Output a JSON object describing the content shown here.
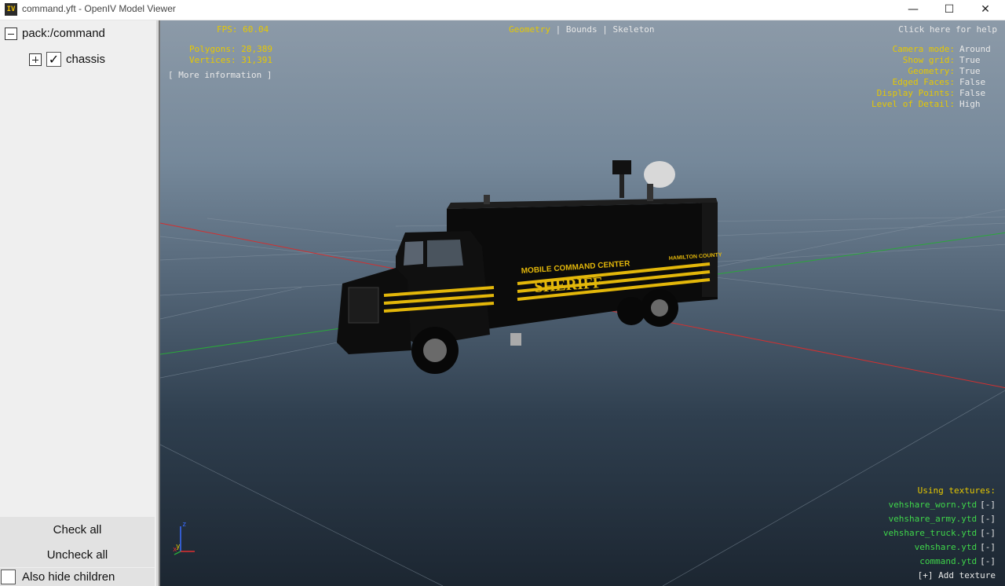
{
  "window": {
    "title": "command.yft - OpenIV Model Viewer",
    "app_icon": "IV",
    "buttons": {
      "minimize": "—",
      "maximize": "☐",
      "close": "✕"
    }
  },
  "tree": {
    "root_label": "pack:/command",
    "child_label": "chassis",
    "child_checked": true
  },
  "panel_buttons": {
    "check_all": "Check all",
    "uncheck_all": "Uncheck all",
    "also_hide_children": "Also hide children"
  },
  "hud": {
    "fps": "FPS: 60.04",
    "polygons": "Polygons: 28,389",
    "vertices": "Vertices: 31,391",
    "more_info": "[ More information ]",
    "help": "Click here for help",
    "modes": {
      "geometry": "Geometry",
      "bounds": "Bounds",
      "skeleton": "Skeleton",
      "active": "Geometry"
    },
    "options": [
      {
        "key": "Camera mode:",
        "value": "Around"
      },
      {
        "key": "Show grid:",
        "value": "True"
      },
      {
        "key": "Geometry:",
        "value": "True"
      },
      {
        "key": "Edged Faces:",
        "value": "False"
      },
      {
        "key": "Display Points:",
        "value": "False"
      },
      {
        "key": "Level of Detail:",
        "value": "High"
      }
    ],
    "textures_title": "Using textures:",
    "textures": [
      "vehshare_worn.ytd",
      "vehshare_army.ytd",
      "vehshare_truck.ytd",
      "vehshare.ytd",
      "command.ytd"
    ],
    "texture_remove": "[-]",
    "add_texture": "[+] Add texture"
  },
  "truck": {
    "decal_main": "SHERIFF",
    "decal_top": "MOBILE COMMAND CENTER",
    "decal_county": "HAMILTON COUNTY",
    "stripe_color": "#e3b70a"
  },
  "axis_labels": {
    "x": "x",
    "y": "y",
    "z": "z"
  }
}
